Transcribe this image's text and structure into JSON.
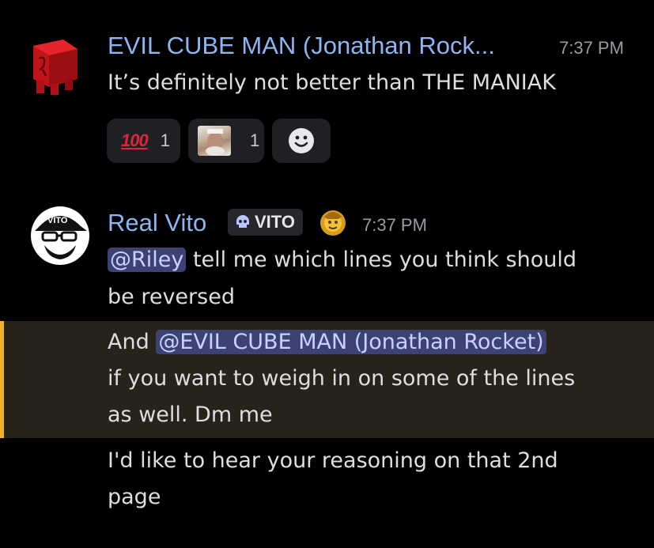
{
  "messages": [
    {
      "author": "EVIL CUBE MAN (Jonathan Rock...",
      "time": "7:37 PM",
      "avatar_icon": "red-cube-avatar-icon",
      "text": "It’s definitely not better than THE MANIAK",
      "reactions": [
        {
          "emoji": "100",
          "emoji_icon": "hundred-points-icon",
          "count": "1"
        },
        {
          "emoji_icon": "custom-photo-emoji-icon",
          "count": "1"
        }
      ],
      "add_reaction_icon": "add-reaction-icon"
    },
    {
      "author": "Real Vito",
      "server_tag": "VITO",
      "server_tag_icon": "skull-icon",
      "badge_icon": "gold-coin-badge-icon",
      "time": "7:37 PM",
      "avatar_icon": "vito-avatar-icon",
      "avatar_cap_text": "VITO",
      "lines": [
        {
          "mention": "@Riley",
          "text": " tell me which lines you think should",
          "continued": "be reversed"
        },
        {
          "prefix": "And ",
          "mention": "@EVIL CUBE MAN (Jonathan Rocket)",
          "line2": "if you want to weigh in on some of the lines",
          "line3": "as well. Dm me",
          "highlighted": true
        },
        {
          "line1": "I'd like to hear your reasoning on that 2nd",
          "line2": "page"
        }
      ]
    }
  ],
  "colors": {
    "background": "#000000",
    "author": "#8fb4f2",
    "mention_bg": "#3c4373",
    "mention_text": "#c9d2ff",
    "highlight_bg": "#27231a",
    "highlight_bar": "#f0b232",
    "reaction_bg": "#1f2024",
    "hundred_red": "#e0243c"
  }
}
